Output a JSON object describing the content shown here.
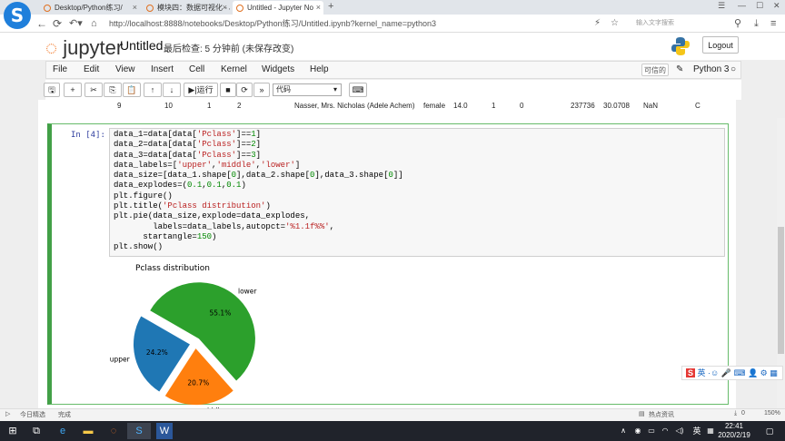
{
  "browser": {
    "tabs": [
      {
        "label": "Desktop/Python练习/"
      },
      {
        "label": "模块四：数据可视化 - J"
      },
      {
        "label": "Untitled - Jupyter No"
      }
    ],
    "add_tab": "+",
    "url": "http://localhost:8888/notebooks/Desktop/Python练习/Untitled.ipynb?kernel_name=python3",
    "search_placeholder": "输入文字搜索"
  },
  "jupyter": {
    "logo": "jupyter",
    "notebook_name": "Untitled",
    "checkpoint": "最后检查: 5 分钟前  (未保存改变)",
    "logout": "Logout",
    "menus": [
      "File",
      "Edit",
      "View",
      "Insert",
      "Cell",
      "Kernel",
      "Widgets",
      "Help"
    ],
    "trusted": "可信的",
    "kernel": "Python 3",
    "toolbar": {
      "run": "运行",
      "cell_type": "代码"
    }
  },
  "prev_row": [
    "9",
    "10",
    "1",
    "2",
    "Nasser, Mrs. Nicholas (Adele Achem)",
    "female",
    "14.0",
    "1",
    "0",
    "237736",
    "30.0708",
    "NaN",
    "C"
  ],
  "cell": {
    "prompt": "In  [4]:"
  },
  "chart_data": {
    "type": "pie",
    "title": "Pclass distribution",
    "labels": [
      "upper",
      "middle",
      "lower"
    ],
    "values": [
      24.2,
      20.7,
      55.1
    ],
    "autopct": [
      "24.2%",
      "20.7%",
      "55.1%"
    ],
    "explode": [
      0.1,
      0.1,
      0.1
    ],
    "startangle": 150,
    "colors": [
      "#1f77b4",
      "#ff7f0e",
      "#2ca02c"
    ]
  },
  "statusbar": {
    "left1": "今日精选",
    "left2": "完成",
    "hot": "热点资讯",
    "zoom": "150%",
    "downloads": "0"
  },
  "ime": {
    "label": "英"
  },
  "taskbar": {
    "time": "22:41",
    "date": "2020/2/19",
    "lang": "英"
  }
}
